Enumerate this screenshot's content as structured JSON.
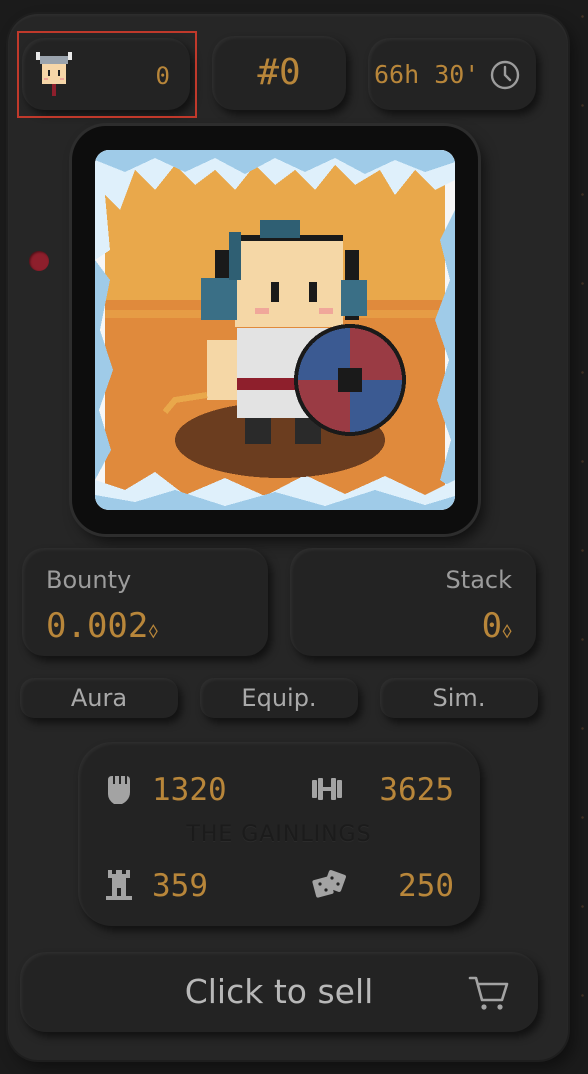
{
  "header": {
    "owner_count": "0",
    "rank": "#0",
    "time_left": "66h 30'"
  },
  "bounty": {
    "label": "Bounty",
    "value": "0.002",
    "unit": "⬨"
  },
  "stack": {
    "label": "Stack",
    "value": "0",
    "unit": "⬨"
  },
  "tabs": [
    {
      "label": "Aura"
    },
    {
      "label": "Equip."
    },
    {
      "label": "Sim."
    }
  ],
  "stats": {
    "strength": "1320",
    "fitness": "3625",
    "team": "THE GAINLINGS",
    "defense": "359",
    "luck": "250"
  },
  "sell": {
    "label": "Click to sell"
  },
  "colors": {
    "accent": "#b8863a",
    "card": "#262626",
    "marker": "#8e1f2c"
  },
  "icons": [
    "viking-avatar-icon",
    "clock-icon",
    "fist-icon",
    "dumbbell-icon",
    "tower-icon",
    "dice-icon",
    "cart-icon"
  ]
}
